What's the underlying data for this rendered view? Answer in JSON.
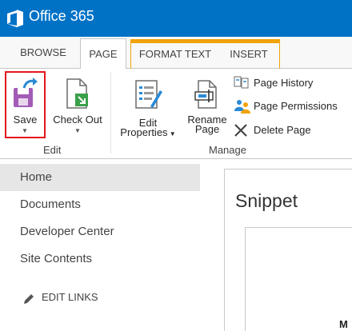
{
  "suite_bar": {
    "title": "Office 365",
    "color": "#0072c6"
  },
  "ribbon": {
    "tabs": [
      {
        "label": "BROWSE"
      },
      {
        "label": "PAGE"
      },
      {
        "label": "FORMAT TEXT"
      },
      {
        "label": "INSERT"
      }
    ],
    "active_tab": "PAGE",
    "contextual_group_color": "#f0a30a",
    "groups": {
      "edit": {
        "label": "Edit",
        "save_label": "Save",
        "checkout_label": "Check Out"
      },
      "manage": {
        "label": "Manage",
        "edit_properties_line1": "Edit",
        "edit_properties_line2": "Properties",
        "rename_line1": "Rename",
        "rename_line2": "Page",
        "page_history": "Page History",
        "page_permissions": "Page Permissions",
        "delete_page": "Delete Page"
      }
    },
    "highlight_color": "#e3161b"
  },
  "left_nav": {
    "items": [
      {
        "label": "Home"
      },
      {
        "label": "Documents"
      },
      {
        "label": "Developer Center"
      },
      {
        "label": "Site Contents"
      }
    ],
    "edit_links": "EDIT LINKS"
  },
  "content": {
    "title": "Snippet",
    "partial_text": "M"
  }
}
